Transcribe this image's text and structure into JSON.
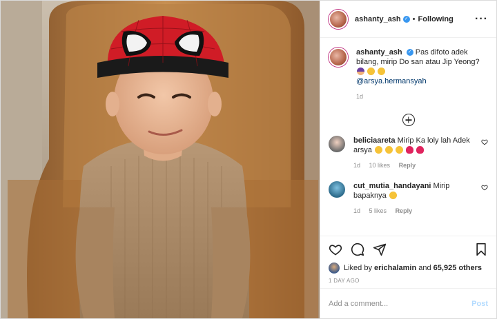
{
  "post": {
    "author": "ashanty_ash",
    "follow_status": "Following",
    "more_icon": "more-horizontal-icon",
    "dot": "•"
  },
  "caption": {
    "author": "ashanty_ash",
    "text": "Pas difoto adek bilang, mirip Do san atau Jip Yeong?",
    "mention": "@arsya.hermansyah",
    "time": "1d"
  },
  "comments": [
    {
      "author": "beliciaareta",
      "text": "Mirip Ka loly lah Adek arsya",
      "time": "1d",
      "likes": "10 likes",
      "reply": "Reply"
    },
    {
      "author": "cut_mutia_handayani",
      "text": "Mirip bapaknya",
      "time": "1d",
      "likes": "5 likes",
      "reply": "Reply"
    }
  ],
  "likes": {
    "prefix": "Liked by",
    "user": "erichalamin",
    "and": "and",
    "count": "65,925 others"
  },
  "timestamp": "1 DAY AGO",
  "add_comment": {
    "placeholder": "Add a comment...",
    "post_label": "Post"
  },
  "colors": {
    "accent": "#3897f0",
    "post_disabled": "#b3dbff",
    "link": "#00376b"
  }
}
